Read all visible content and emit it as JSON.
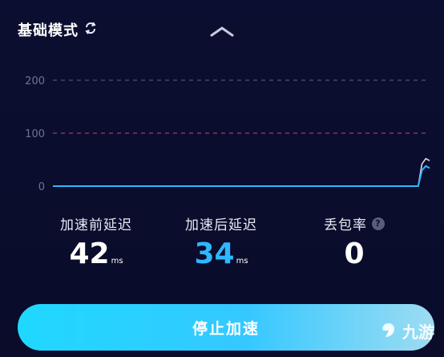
{
  "header": {
    "mode_title": "基础模式",
    "switch_icon": "refresh-icon"
  },
  "chart_data": {
    "type": "line",
    "y_ticks": [
      "200",
      "100",
      "0"
    ],
    "ylim": [
      0,
      200
    ],
    "threshold_lines": [
      {
        "value": 200,
        "color": "#5e6486"
      },
      {
        "value": 100,
        "color": "#c44a5a"
      }
    ],
    "series": [
      {
        "values": [
          0,
          0,
          0,
          0,
          0,
          0,
          0,
          0,
          0,
          0,
          0,
          0,
          0,
          0,
          0,
          0,
          0,
          0,
          0,
          0,
          0,
          0,
          0,
          0,
          0,
          0,
          0,
          0,
          0,
          0,
          0,
          0,
          0,
          0,
          0,
          0,
          0,
          0,
          0,
          0,
          0,
          0,
          0,
          0,
          0,
          0,
          0,
          0,
          0,
          0,
          0,
          0,
          0,
          0,
          0,
          0,
          0,
          0,
          0,
          0,
          0,
          0,
          0,
          0,
          0,
          0,
          0,
          0,
          0,
          0,
          0,
          0,
          0,
          0,
          0,
          0,
          0,
          0,
          0,
          0,
          0,
          0,
          0,
          0,
          0,
          0,
          0,
          0,
          0,
          0,
          0,
          0,
          0,
          0,
          0,
          0,
          0,
          42,
          52,
          48
        ],
        "color": "#d9dbe8"
      },
      {
        "values": [
          0,
          0,
          0,
          0,
          0,
          0,
          0,
          0,
          0,
          0,
          0,
          0,
          0,
          0,
          0,
          0,
          0,
          0,
          0,
          0,
          0,
          0,
          0,
          0,
          0,
          0,
          0,
          0,
          0,
          0,
          0,
          0,
          0,
          0,
          0,
          0,
          0,
          0,
          0,
          0,
          0,
          0,
          0,
          0,
          0,
          0,
          0,
          0,
          0,
          0,
          0,
          0,
          0,
          0,
          0,
          0,
          0,
          0,
          0,
          0,
          0,
          0,
          0,
          0,
          0,
          0,
          0,
          0,
          0,
          0,
          0,
          0,
          0,
          0,
          0,
          0,
          0,
          0,
          0,
          0,
          0,
          0,
          0,
          0,
          0,
          0,
          0,
          0,
          0,
          0,
          0,
          0,
          0,
          0,
          0,
          0,
          0,
          30,
          38,
          34
        ],
        "color": "#2fb7ff"
      }
    ]
  },
  "stats": {
    "before": {
      "label": "加速前延迟",
      "value": "42",
      "unit": "ms",
      "color": "#ffffff"
    },
    "after": {
      "label": "加速后延迟",
      "value": "34",
      "unit": "ms",
      "color": "#2fb7ff"
    },
    "loss": {
      "label": "丢包率",
      "value": "0",
      "help": "?"
    }
  },
  "actions": {
    "stop_label": "停止加速"
  },
  "watermark": {
    "text": "九游"
  }
}
